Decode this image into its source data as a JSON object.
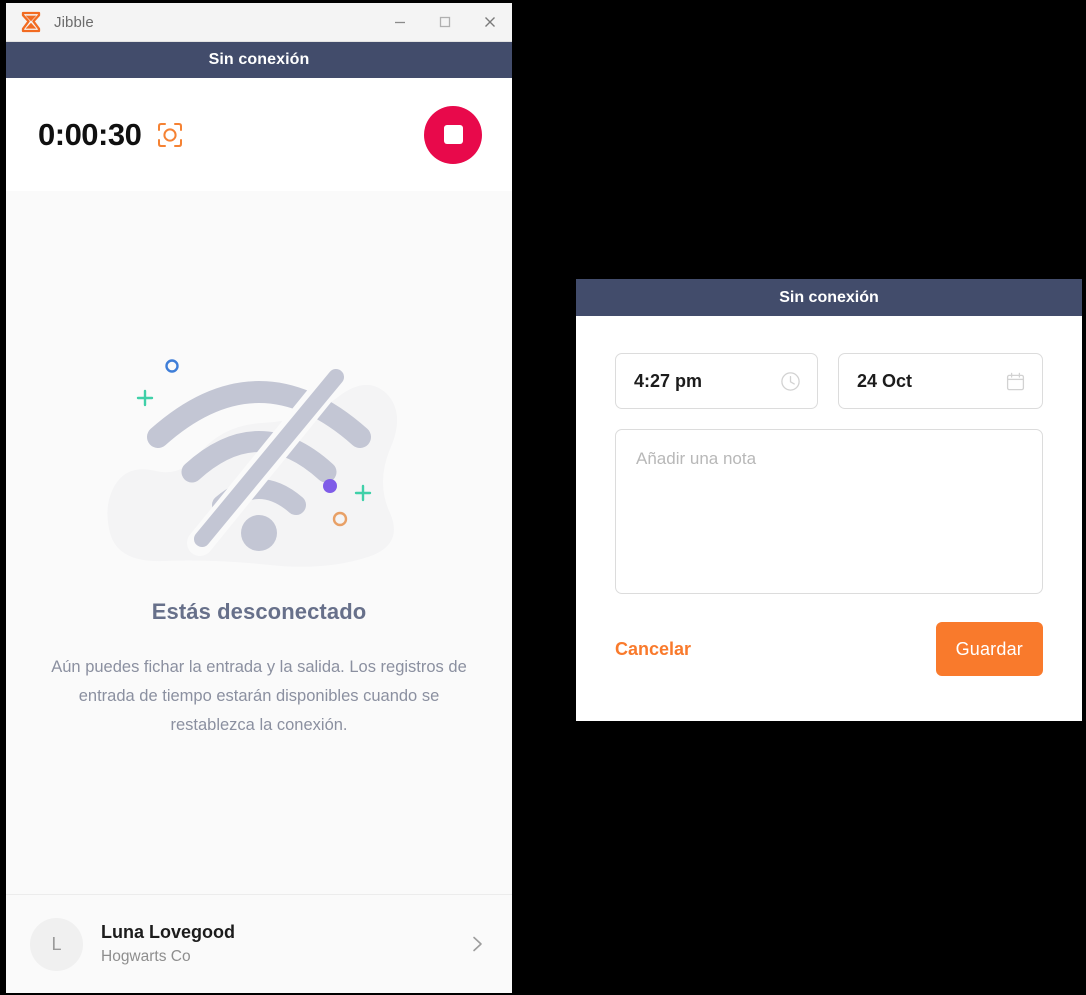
{
  "app_window": {
    "titlebar": {
      "logo_icon": "jibble-hourglass-icon",
      "title": "Jibble",
      "minimize_icon": "minimize-icon",
      "maximize_icon": "maximize-icon",
      "close_icon": "close-icon"
    },
    "status_bar": {
      "text": "Sin conexión"
    },
    "timer": {
      "value": "0:00:30",
      "scan_icon": "face-scan-icon",
      "stop_icon": "stop-square-icon"
    },
    "offline": {
      "illustration_icon": "wifi-off-illustration",
      "title": "Estás desconectado",
      "description": "Aún puedes fichar la entrada y la salida. Los registros de entrada de tiempo estarán disponibles cuando se restablezca la conexión."
    },
    "user": {
      "avatar_initial": "L",
      "name": "Luna Lovegood",
      "organization": "Hogwarts Co",
      "chevron_icon": "chevron-right-icon"
    }
  },
  "dialog": {
    "header": {
      "text": "Sin conexión"
    },
    "time_field": {
      "value": "4:27 pm",
      "icon": "clock-icon"
    },
    "date_field": {
      "value": "24 Oct",
      "icon": "calendar-icon"
    },
    "note_field": {
      "value": "",
      "placeholder": "Añadir una nota"
    },
    "cancel_label": "Cancelar",
    "save_label": "Guardar"
  },
  "colors": {
    "header_slate": "#424C6B",
    "accent_orange": "#F97A2C",
    "stop_red": "#E8094B",
    "body_background": "#FAFAFA",
    "page_background": "#000000",
    "text_muted": "#8B90A0"
  }
}
